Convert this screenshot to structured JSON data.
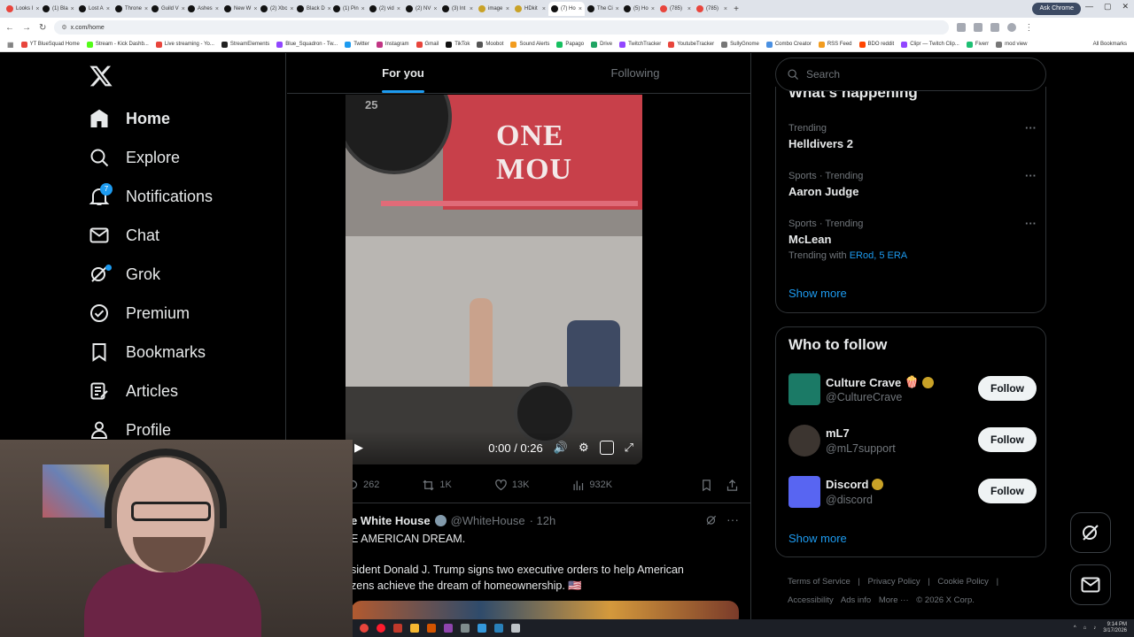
{
  "browser": {
    "tabs": [
      {
        "label": "Looks I",
        "color": "#e8453c"
      },
      {
        "label": "(1) Bla",
        "color": "#111111"
      },
      {
        "label": "Lost A",
        "color": "#111111"
      },
      {
        "label": "Throne",
        "color": "#111111"
      },
      {
        "label": "Guild V",
        "color": "#111111"
      },
      {
        "label": "Ashes",
        "color": "#111111"
      },
      {
        "label": "New W",
        "color": "#111111"
      },
      {
        "label": "(2) Xbc",
        "color": "#111111"
      },
      {
        "label": "Black D",
        "color": "#111111"
      },
      {
        "label": "(1) Pin",
        "color": "#111111"
      },
      {
        "label": "(2) vid",
        "color": "#111111"
      },
      {
        "label": "(2) NV",
        "color": "#111111"
      },
      {
        "label": "(3) lnt",
        "color": "#111111"
      },
      {
        "label": "image",
        "color": "#c9a227"
      },
      {
        "label": "HDkit",
        "color": "#c9a227"
      },
      {
        "label": "(7) Ho",
        "color": "#111111",
        "active": true
      },
      {
        "label": "The Ci",
        "color": "#111111"
      },
      {
        "label": "(5) Ho",
        "color": "#111111"
      },
      {
        "label": "(785)",
        "color": "#e8453c"
      },
      {
        "label": "(785)",
        "color": "#e8453c"
      }
    ],
    "new_tab": "+",
    "ask_chrome": "Ask Chrome",
    "url": "x.com/home",
    "bookmarks": [
      {
        "label": "YT BlueSquad Home",
        "color": "#e8453c"
      },
      {
        "label": "Stream - Kick Dashb...",
        "color": "#53fc18"
      },
      {
        "label": "Live streaming - Yo...",
        "color": "#e8453c"
      },
      {
        "label": "StreamElements",
        "color": "#222222"
      },
      {
        "label": "Blue_Squadron - Tw...",
        "color": "#9146ff"
      },
      {
        "label": "Twitter",
        "color": "#1d9bf0"
      },
      {
        "label": "Instagram",
        "color": "#c13584"
      },
      {
        "label": "Gmail",
        "color": "#e8453c"
      },
      {
        "label": "TikTok",
        "color": "#111111"
      },
      {
        "label": "Moobot",
        "color": "#555555"
      },
      {
        "label": "Sound Alerts",
        "color": "#f29c1f"
      },
      {
        "label": "Papago",
        "color": "#16c060"
      },
      {
        "label": "Drive",
        "color": "#1fa463"
      },
      {
        "label": "TwitchTracker",
        "color": "#9146ff"
      },
      {
        "label": "YoutubeTracker",
        "color": "#e8453c"
      },
      {
        "label": "SullyGnome",
        "color": "#777777"
      },
      {
        "label": "Combo Creator",
        "color": "#4a90e2"
      },
      {
        "label": "RSS Feed",
        "color": "#f29c1f"
      },
      {
        "label": "BDO reddit",
        "color": "#ff4500"
      },
      {
        "label": "Clipr — Twitch Clip...",
        "color": "#9146ff"
      },
      {
        "label": "Fiverr",
        "color": "#1dbf73"
      },
      {
        "label": "mod view",
        "color": "#777777"
      }
    ],
    "all_bookmarks": "All Bookmarks"
  },
  "sidebar": {
    "items": [
      {
        "label": "Home",
        "icon": "home-icon"
      },
      {
        "label": "Explore",
        "icon": "search-icon"
      },
      {
        "label": "Notifications",
        "icon": "bell-icon",
        "badge": "7"
      },
      {
        "label": "Chat",
        "icon": "mail-icon"
      },
      {
        "label": "Grok",
        "icon": "grok-icon"
      },
      {
        "label": "Premium",
        "icon": "verified-icon"
      },
      {
        "label": "Bookmarks",
        "icon": "bookmark-icon"
      },
      {
        "label": "Articles",
        "icon": "article-icon"
      },
      {
        "label": "Profile",
        "icon": "person-icon"
      }
    ]
  },
  "feed": {
    "tabs": [
      "For you",
      "Following"
    ],
    "video": {
      "sign_text": "ONE MOU",
      "plate_text": "25",
      "time": "0:00 / 0:26"
    },
    "actions": {
      "replies": "262",
      "reposts": "1K",
      "likes": "13K",
      "views": "932K"
    },
    "tweet2": {
      "name": "e White House",
      "handle": "@WhiteHouse",
      "time": "· 12h",
      "line1": "E AMERICAN DREAM.",
      "line2": "sident Donald J. Trump signs two executive orders to help American",
      "line3": "zens achieve the dream of homeownership. 🇺🇸"
    }
  },
  "right": {
    "search_placeholder": "Search",
    "happening_title": "What’s happening",
    "trends": [
      {
        "category": "Trending",
        "name": "Helldivers 2"
      },
      {
        "category": "Sports · Trending",
        "name": "Aaron Judge"
      },
      {
        "category": "Sports · Trending",
        "name": "McLean",
        "with": "Trending with",
        "links": "ERod, 5 ERA"
      }
    ],
    "show_more": "Show more",
    "wtf_title": "Who to follow",
    "follows": [
      {
        "name": "Culture Crave",
        "emoji": "🍿",
        "handle": "@CultureCrave",
        "avatar_color": "#1b7a66",
        "verified": true
      },
      {
        "name": "mL7",
        "emoji": "",
        "handle": "@mL7support",
        "avatar_color": "#3c3530",
        "verified": false
      },
      {
        "name": "Discord",
        "emoji": "",
        "handle": "@discord",
        "avatar_color": "#5865f2",
        "verified": true
      }
    ],
    "follow_label": "Follow",
    "footer": [
      "Terms of Service",
      "|",
      "Privacy Policy",
      "|",
      "Cookie Policy",
      "|",
      "Accessibility",
      "Ads info",
      "More ···",
      "© 2026 X Corp."
    ]
  },
  "taskbar": {
    "time": "9:14 PM",
    "date": "3/17/2026"
  },
  "colors": {
    "accent": "#1d9bf0",
    "background": "#000000",
    "border": "#2f3336",
    "muted": "#71767b"
  }
}
